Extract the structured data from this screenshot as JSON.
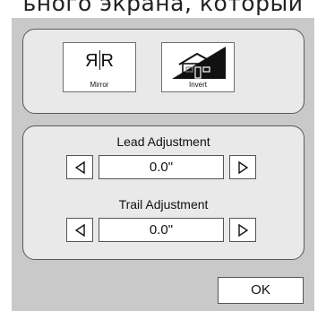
{
  "caption": "ьного экрана, который",
  "tools": {
    "mirror": {
      "label": "Mirror",
      "glyph_left": "R",
      "glyph_right": "R",
      "icon": "mirror-icon"
    },
    "invert": {
      "label": "Invert",
      "icon": "invert-house-icon"
    }
  },
  "lead": {
    "title": "Lead Adjustment",
    "value": "0.0\""
  },
  "trail": {
    "title": "Trail Adjustment",
    "value": "0.0\""
  },
  "ok_label": "OK",
  "colors": {
    "dialog_bg": "#c9c9c9",
    "panel_bg": "#e9e9e9",
    "button_bg": "#ffffff",
    "border": "#555555"
  }
}
